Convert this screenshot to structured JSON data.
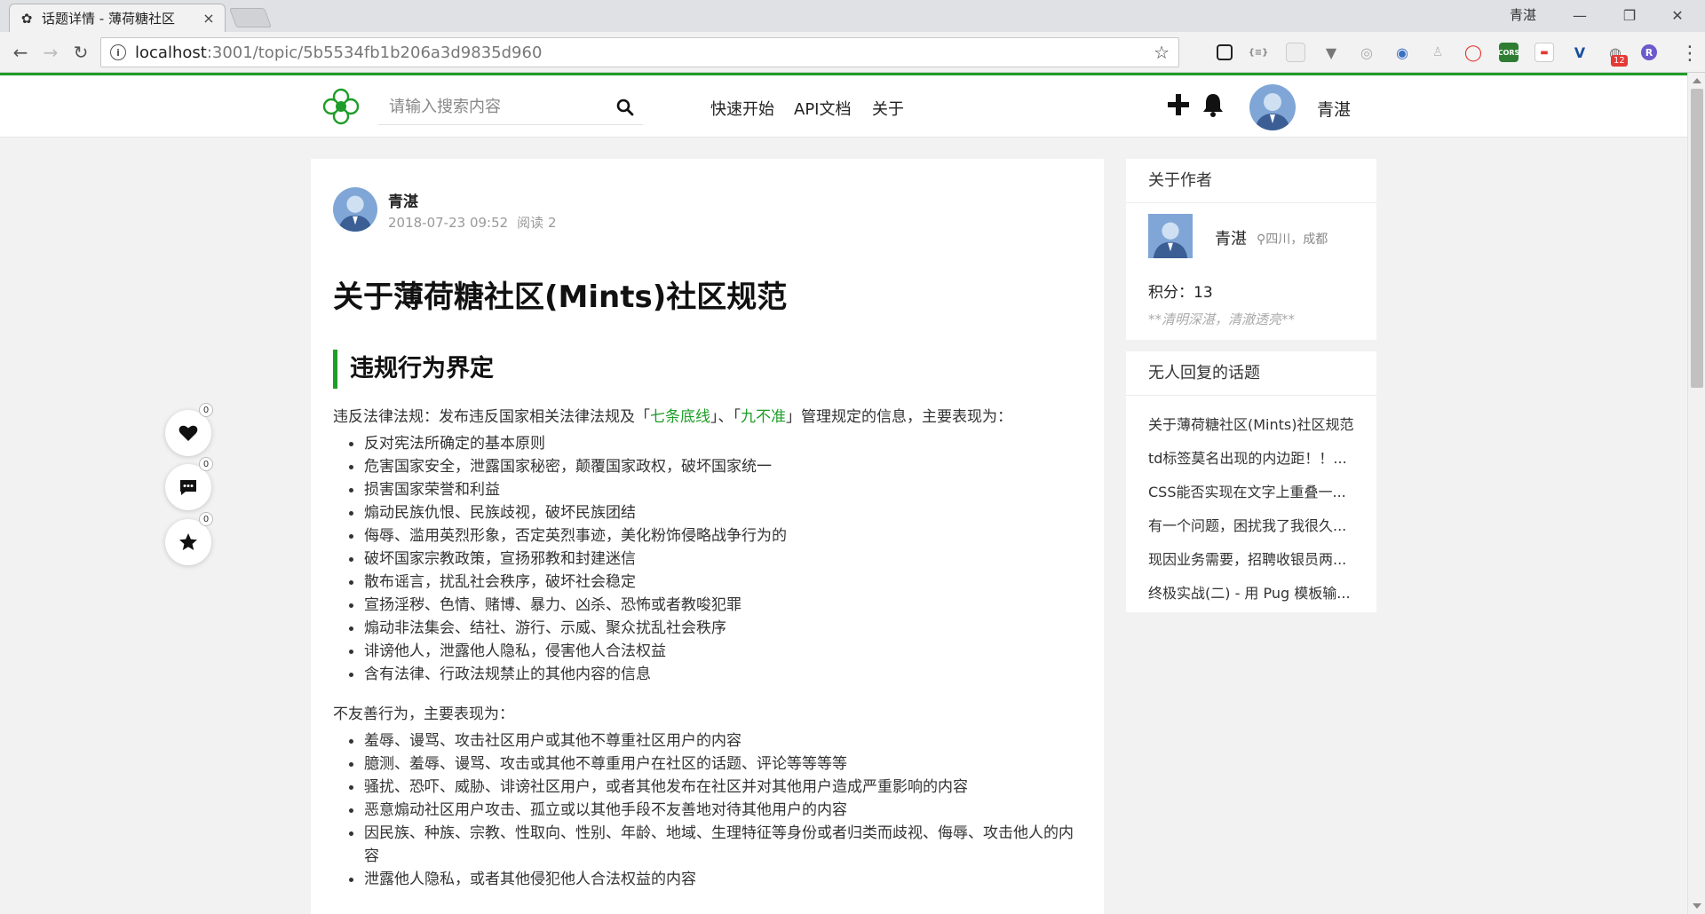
{
  "browser": {
    "tab_title": "话题详情 - 薄荷糖社区",
    "tab_close": "×",
    "window_user": "青湛",
    "url_host": "localhost",
    "url_path": ":3001/topic/5b5534fb1b206a3d9835d960",
    "extension_badge": "12",
    "ext_labels": {
      "json": "{≡}",
      "cors": "CORS",
      "r": "R"
    }
  },
  "header": {
    "search_placeholder": "请输入搜索内容",
    "nav": [
      "快速开始",
      "API文档",
      "关于"
    ],
    "username": "青湛"
  },
  "actions": {
    "like_count": "0",
    "comment_count": "0",
    "collect_count": "0"
  },
  "article": {
    "author": "青湛",
    "date": "2018-07-23 09:52",
    "reads": "阅读 2",
    "title": "关于薄荷糖社区(Mints)社区规范",
    "section_title": "违规行为界定",
    "intro_prefix": "违反法律法规：发布违反国家相关法律法规及「",
    "link1": "七条底线",
    "intro_mid": "」、「",
    "link2": "九不准",
    "intro_suffix": "」管理规定的信息，主要表现为：",
    "list1": [
      "反对宪法所确定的基本原则",
      "危害国家安全，泄露国家秘密，颠覆国家政权，破坏国家统一",
      "损害国家荣誉和利益",
      "煽动民族仇恨、民族歧视，破坏民族团结",
      "侮辱、滥用英烈形象，否定英烈事迹，美化粉饰侵略战争行为的",
      "破坏国家宗教政策，宣扬邪教和封建迷信",
      "散布谣言，扰乱社会秩序，破坏社会稳定",
      "宣扬淫秽、色情、赌博、暴力、凶杀、恐怖或者教唆犯罪",
      "煽动非法集会、结社、游行、示威、聚众扰乱社会秩序",
      "诽谤他人，泄露他人隐私，侵害他人合法权益",
      "含有法律、行政法规禁止的其他内容的信息"
    ],
    "para2": "不友善行为，主要表现为：",
    "list2": [
      "羞辱、谩骂、攻击社区用户或其他不尊重社区用户的内容",
      "臆测、羞辱、谩骂、攻击或其他不尊重用户在社区的话题、评论等等等等",
      "骚扰、恐吓、威胁、诽谤社区用户，或者其他发布在社区并对其他用户造成严重影响的内容",
      "恶意煽动社区用户攻击、孤立或以其他手段不友善地对待其他用户的内容",
      "因民族、种族、宗教、性取向、性别、年龄、地域、生理特征等身份或者归类而歧视、侮辱、攻击他人的内容",
      "泄露他人隐私，或者其他侵犯他人合法权益的内容"
    ]
  },
  "sidebar": {
    "about_title": "关于作者",
    "author_name": "青湛",
    "location": "四川，成都",
    "score": "积分：13",
    "motto": "**清明深湛，清澈透亮**",
    "unreplied_title": "无人回复的话题",
    "topics": [
      "关于薄荷糖社区(Mints)社区规范",
      "td标签莫名出现的内边距！！...",
      "CSS能否实现在文字上重叠一...",
      "有一个问题，困扰我了我很久...",
      "现因业务需要，招聘收银员两...",
      "终极实战(二) - 用 Pug 模板输..."
    ]
  },
  "colors": {
    "brand_green": "#1e9d28",
    "page_bg": "#f2f2f2"
  }
}
